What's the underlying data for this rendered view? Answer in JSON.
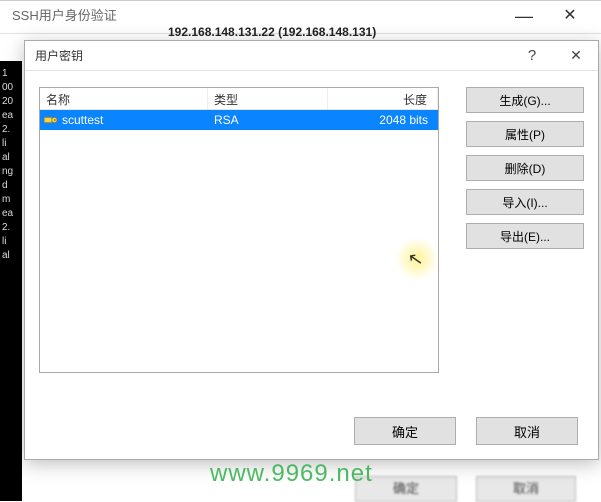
{
  "parent": {
    "title": "SSH用户身份验证",
    "ip_line": "192.168.148.131.22 (192.168.148.131)",
    "left_labels": [
      "1",
      "",
      "00",
      "20",
      "",
      "ea",
      "",
      "2.",
      "li",
      "al",
      "ng",
      "",
      "d",
      "",
      "m",
      "",
      "ea",
      "",
      "2.",
      "li",
      "al"
    ]
  },
  "mid_buttons": {
    "ok": "确定",
    "cancel": "取消"
  },
  "dialog": {
    "title": "用户密钥",
    "help": "?",
    "close": "✕",
    "columns": {
      "name": "名称",
      "type": "类型",
      "length": "长度"
    },
    "rows": [
      {
        "icon": "key-icon",
        "name": "scuttest",
        "type": "RSA",
        "length": "2048 bits"
      }
    ],
    "side_buttons": {
      "generate": "生成(G)...",
      "properties": "属性(P)",
      "delete": "删除(D)",
      "import": "导入(I)...",
      "export": "导出(E)..."
    },
    "footer": {
      "ok": "确定",
      "cancel": "取消"
    }
  },
  "watermark": "www.9969.net"
}
